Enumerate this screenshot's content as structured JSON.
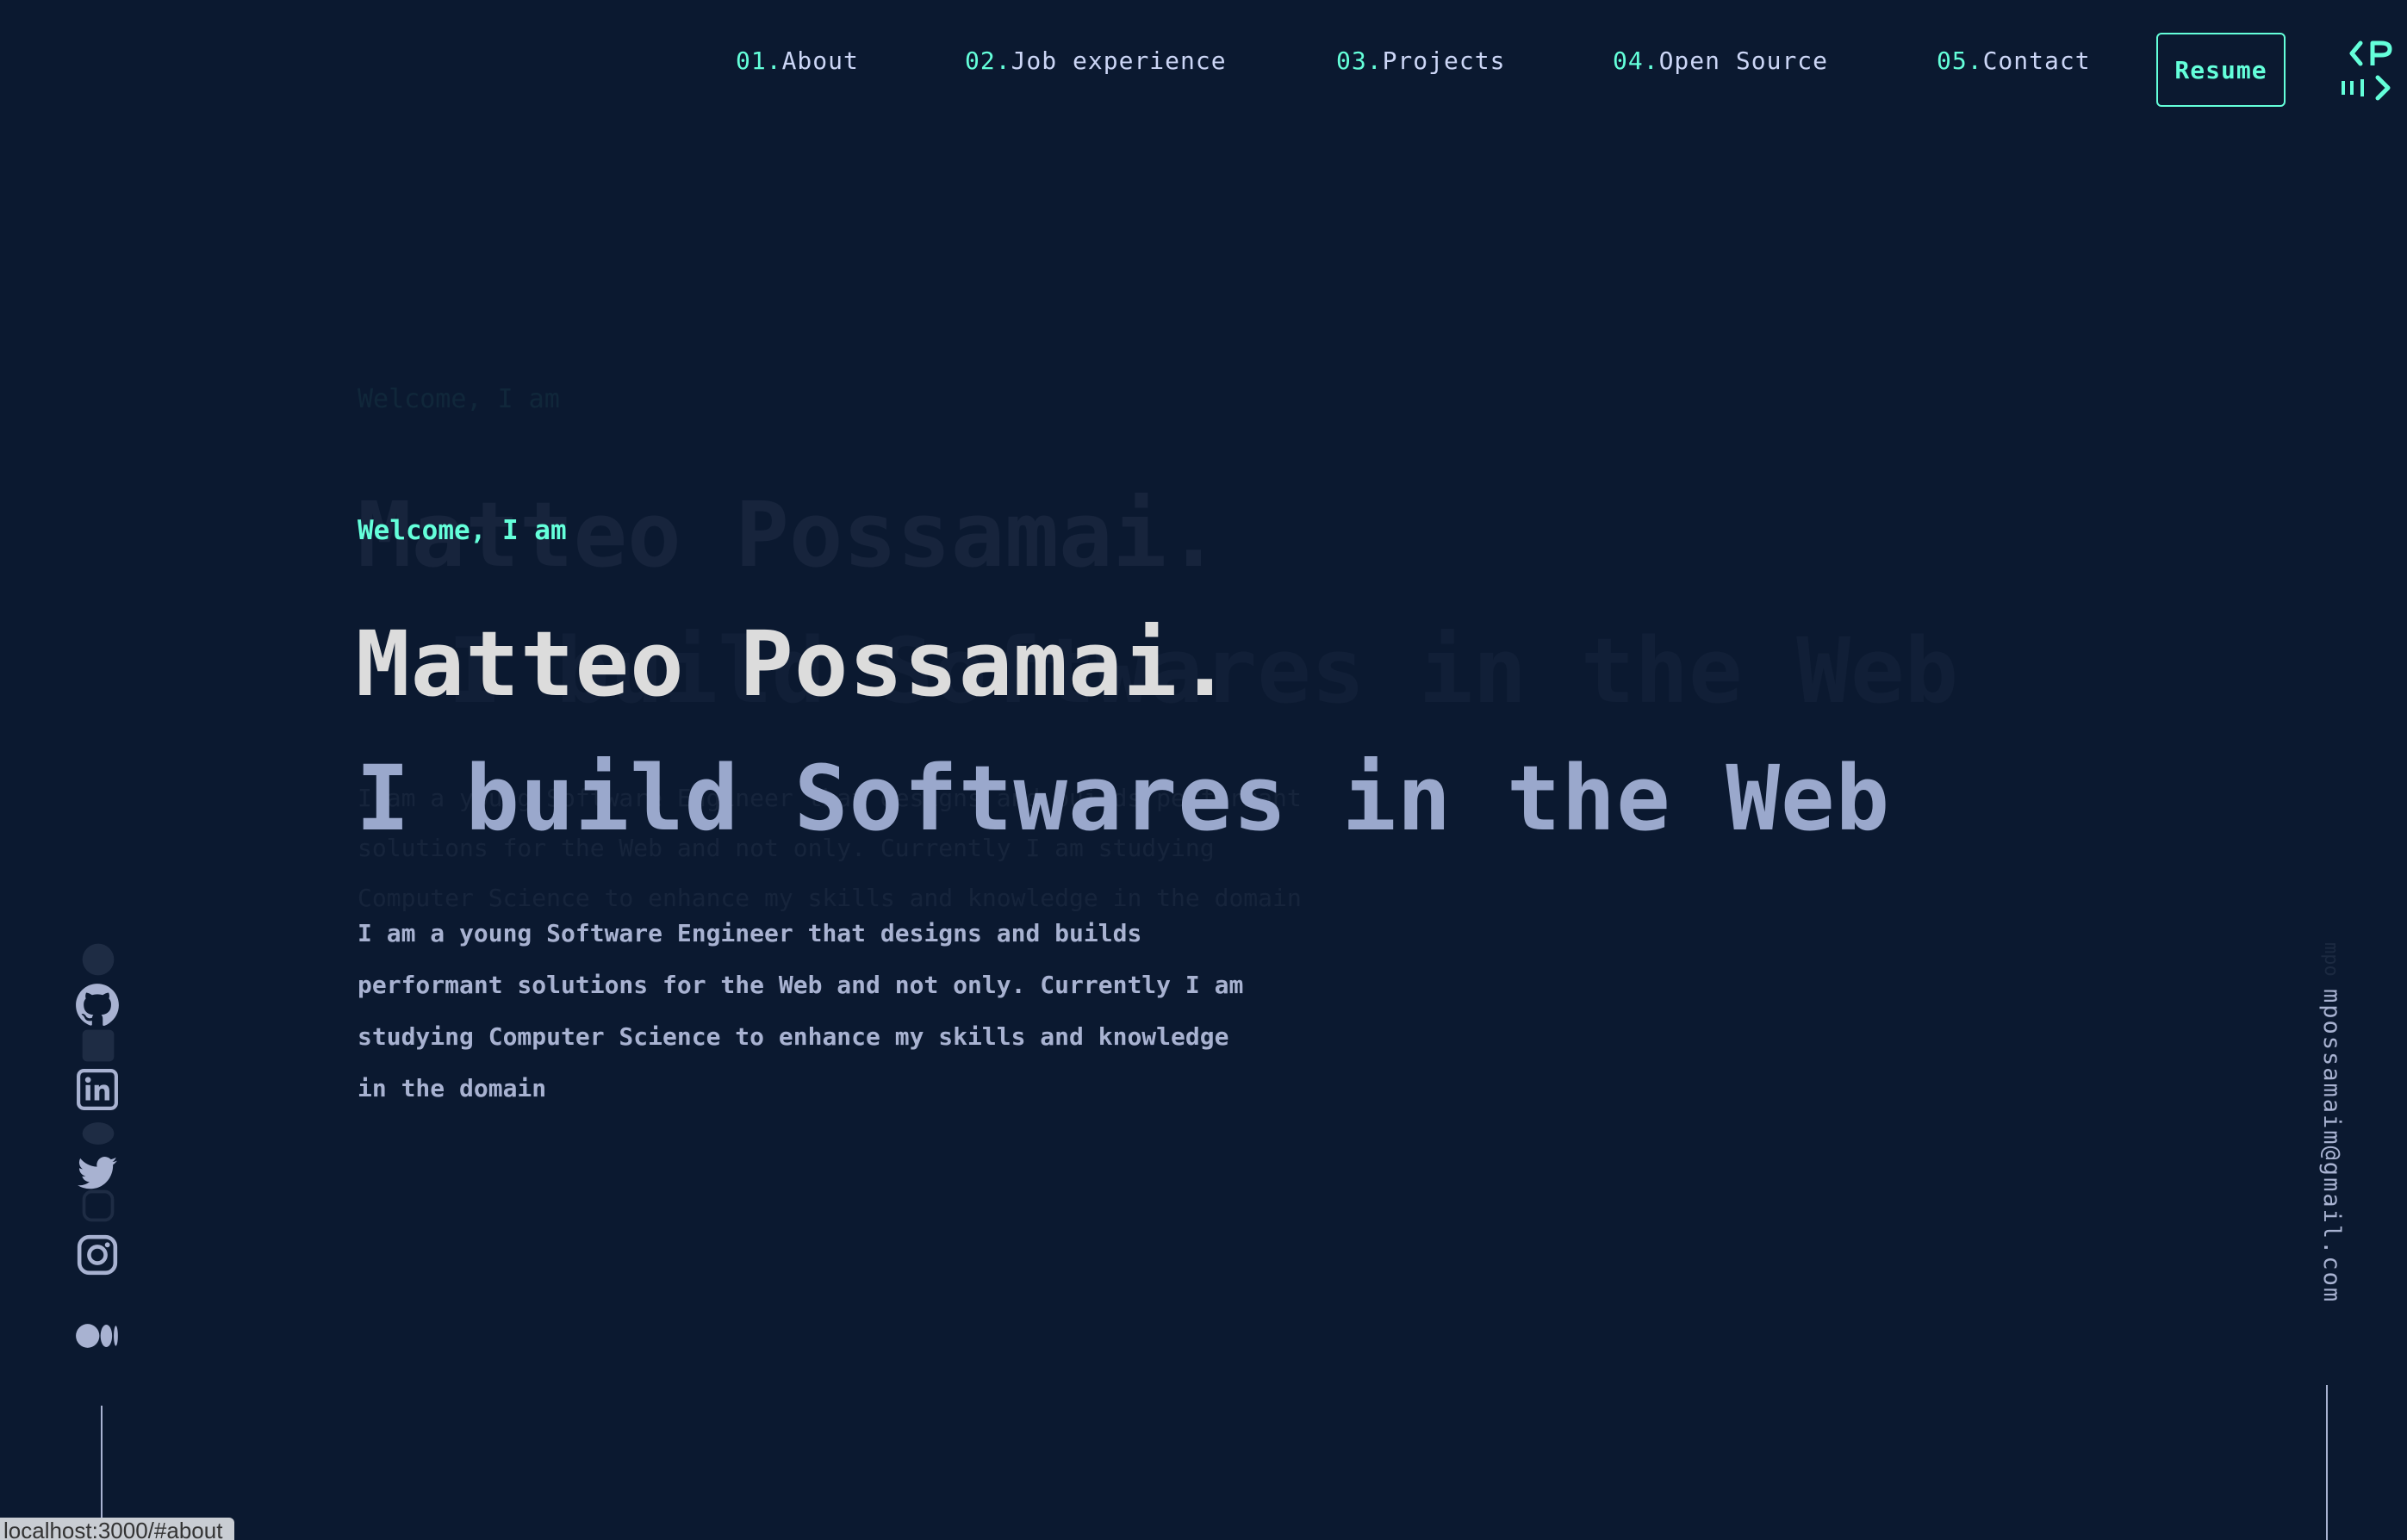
{
  "nav": {
    "items": [
      {
        "num": "01.",
        "label": "About"
      },
      {
        "num": "02.",
        "label": "Job experience"
      },
      {
        "num": "03.",
        "label": "Projects"
      },
      {
        "num": "04.",
        "label": "Open Source"
      },
      {
        "num": "05.",
        "label": "Contact"
      }
    ],
    "resume_label": "Resume",
    "logo_icon": "code-bracket-logo-icon"
  },
  "hero": {
    "welcome": "Welcome, I am",
    "name": "Matteo Possamai.",
    "subtitle": "I build Softwares in the Web",
    "description": "I am a young Software Engineer that designs and builds performant solutions for the Web and not only. Currently I am studying Computer Science to enhance my skills and knowledge in the domain"
  },
  "social": {
    "icons": [
      "github-icon",
      "linkedin-icon",
      "twitter-icon",
      "instagram-icon",
      "medium-icon"
    ]
  },
  "contact": {
    "email": "mpossamaim@gmail.com"
  },
  "status_bar": {
    "url": "localhost:3000/#about"
  },
  "colors": {
    "background": "#0b1930",
    "accent": "#64ffda",
    "text_light": "#ccd6f6",
    "text_muted": "#a8b2d1"
  }
}
